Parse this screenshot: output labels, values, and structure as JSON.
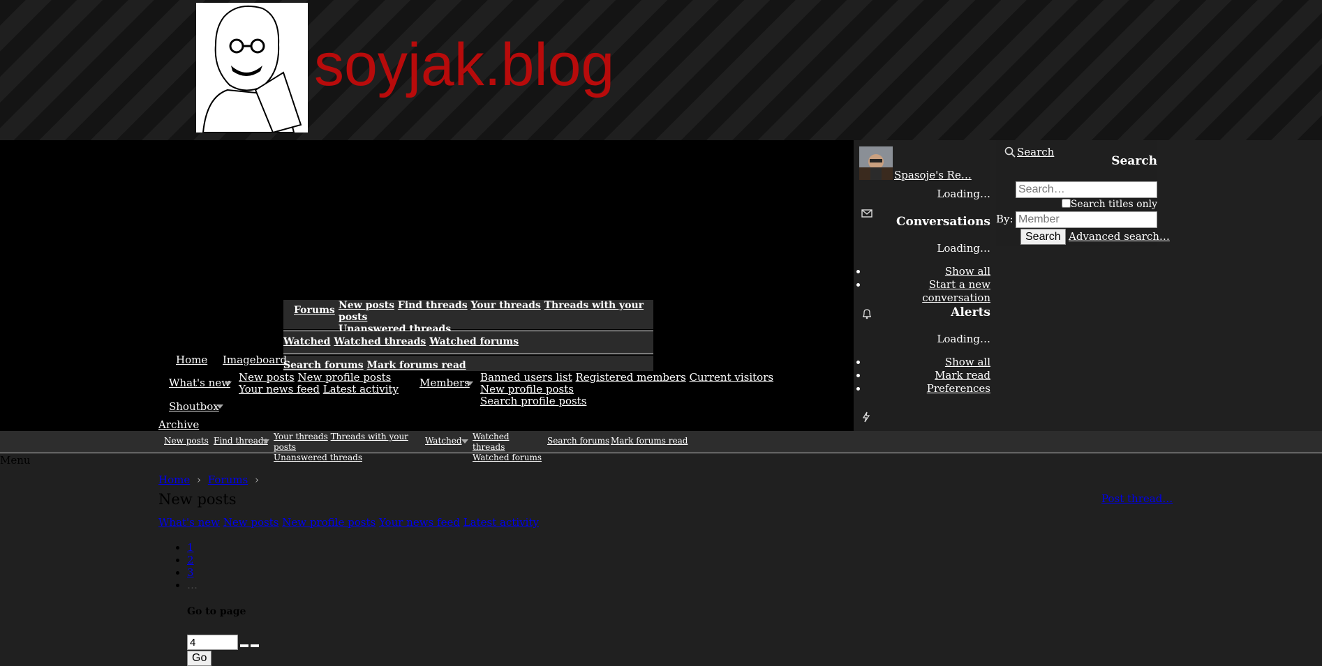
{
  "site": {
    "logo_text": "soyjak.blog"
  },
  "account": {
    "username": "Spasoje's Re…",
    "loading": "Loading…"
  },
  "conversations": {
    "title": "Conversations",
    "loading": "Loading…",
    "links": [
      "Show all",
      "Start a new conversation"
    ]
  },
  "alerts": {
    "title": "Alerts",
    "loading": "Loading…",
    "links": [
      "Show all",
      "Mark read",
      "Preferences"
    ]
  },
  "search_panel": {
    "link": "Search",
    "title": "Search",
    "input_placeholder": "Search…",
    "titles_only_label": "Search titles only",
    "by_label": "By:",
    "member_placeholder": "Member",
    "submit_label": "Search",
    "advanced_link": "Advanced search…"
  },
  "popup": {
    "forums_label": "Forums",
    "forums_links": [
      "New posts",
      "Find threads",
      "Your threads",
      "Threads with your posts",
      "Unanswered threads"
    ],
    "watched_label": "Watched",
    "watched_links": [
      "Watched threads",
      "Watched forums"
    ],
    "search_label": "Search forums",
    "mark_label": "Mark forums read"
  },
  "nav": {
    "home": "Home",
    "imageboard": "Imageboard",
    "whats_new": "What's new",
    "whats_new_links": [
      "New posts",
      "New profile posts",
      "Your news feed",
      "Latest activity"
    ],
    "members": "Members",
    "members_links": [
      "Banned users list",
      "Registered members",
      "Current visitors",
      "New profile posts",
      "Search profile posts"
    ],
    "shoutbox": "Shoutbox",
    "archive": "Archive"
  },
  "subnav": {
    "new_posts": "New posts",
    "find_threads": "Find threads",
    "find_links": [
      "Your threads",
      "Threads with your posts",
      "Unanswered threads"
    ],
    "watched": "Watched",
    "watched_links": [
      "Watched threads",
      "Watched forums"
    ],
    "search_forums": "Search forums",
    "mark_read": "Mark forums read"
  },
  "menu_label": "Menu",
  "breadcrumb": [
    "Home",
    "Forums"
  ],
  "page": {
    "title": "New posts",
    "post_thread": "Post thread…",
    "tabs_text": [
      "What's new",
      "New posts",
      "New profile posts",
      "Your news feed",
      "Latest activity"
    ],
    "pages": [
      "1",
      "2",
      "3",
      "…"
    ],
    "goto_label": "Go to page",
    "goto_value": "4",
    "go_button": "Go"
  }
}
